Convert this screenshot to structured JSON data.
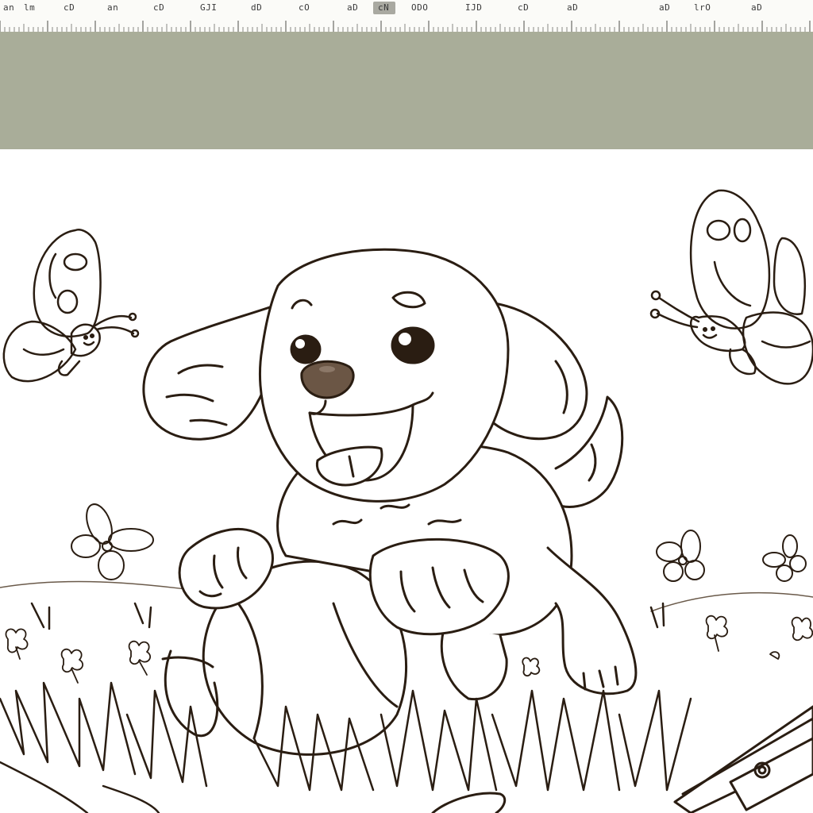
{
  "ruler": {
    "labels": [
      "an",
      "lm",
      "cD",
      "an",
      "cD",
      "GJI",
      "dD",
      "cO",
      "aD",
      "cN",
      "ODO",
      "IJD",
      "cD",
      "aD",
      "aD",
      "lrO",
      "aD"
    ],
    "marker_active": true
  },
  "canvas": {
    "artwork": "coloring-page-puppy",
    "line_color": "#2a1d12",
    "fill_color": "#ffffff",
    "nose_color": "#6b5645",
    "eye_color": "#2a1d12"
  },
  "band": {
    "color": "#a9ad99"
  }
}
